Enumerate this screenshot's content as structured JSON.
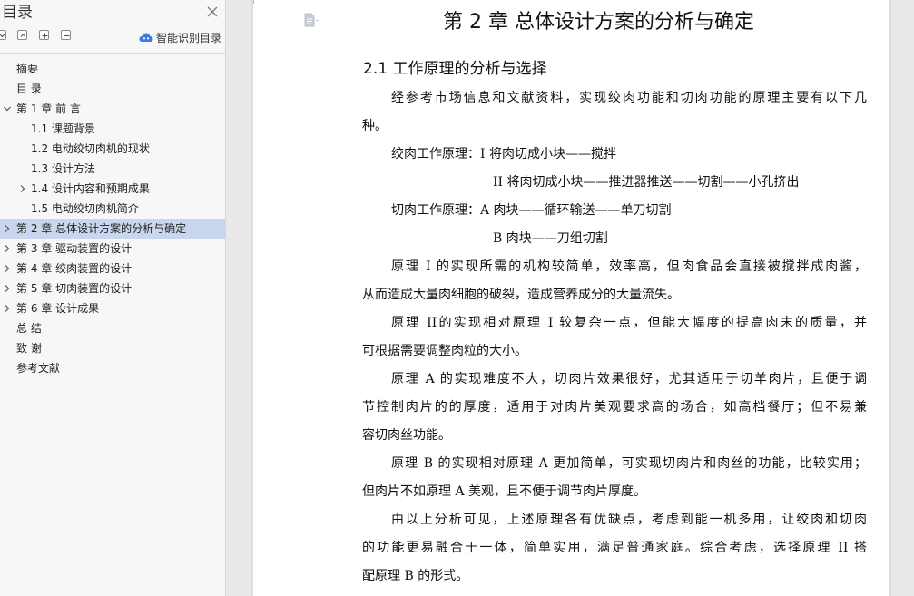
{
  "toc_panel": {
    "title": "目录",
    "smart_toc_label": "智能识别目录",
    "items": [
      {
        "label": "摘要",
        "level": 1,
        "arrow": "none"
      },
      {
        "label": "目 录",
        "level": 1,
        "arrow": "none"
      },
      {
        "label": "第 1 章 前 言",
        "level": 1,
        "arrow": "down"
      },
      {
        "label": "1.1 课题背景",
        "level": 2,
        "arrow": "none"
      },
      {
        "label": "1.2 电动绞切肉机的现状",
        "level": 2,
        "arrow": "none"
      },
      {
        "label": "1.3 设计方法",
        "level": 2,
        "arrow": "none"
      },
      {
        "label": "1.4 设计内容和预期成果",
        "level": 2,
        "arrow": "right"
      },
      {
        "label": "1.5 电动绞切肉机简介",
        "level": 2,
        "arrow": "none"
      },
      {
        "label": "第 2 章 总体设计方案的分析与确定",
        "level": 1,
        "arrow": "right",
        "active": true
      },
      {
        "label": "第 3 章 驱动装置的设计",
        "level": 1,
        "arrow": "right"
      },
      {
        "label": "第 4 章 绞肉装置的设计",
        "level": 1,
        "arrow": "right"
      },
      {
        "label": "第 5 章 切肉装置的设计",
        "level": 1,
        "arrow": "right"
      },
      {
        "label": "第 6 章 设计成果",
        "level": 1,
        "arrow": "right"
      },
      {
        "label": "总 结",
        "level": 1,
        "arrow": "none"
      },
      {
        "label": "致 谢",
        "level": 1,
        "arrow": "none"
      },
      {
        "label": "参考文献",
        "level": 1,
        "arrow": "none"
      }
    ]
  },
  "document": {
    "chapter_title": "第 2 章  总体设计方案的分析与确定",
    "section_title": "2.1  工作原理的分析与选择",
    "lines": {
      "p1a": "经参考市场信息和文献资料，实现绞肉功能和切肉功能的原理主要有以下几",
      "p1b": "种。",
      "p2": "绞肉工作原理：I 将肉切成小块——搅拌",
      "p3": "II 将肉切成小块——推进器推送——切割——小孔挤出",
      "p4": "切肉工作原理：A 肉块——循环输送——单刀切割",
      "p5": "B 肉块——刀组切割",
      "p6a": "原理 I 的实现所需的机构较简单，效率高，但肉食品会直接被搅拌成肉酱，",
      "p6b": "从而造成大量肉细胞的破裂，造成营养成分的大量流失。",
      "p7a": "原理 II的实现相对原理 I 较复杂一点，但能大幅度的提高肉末的质量，并",
      "p7b": "可根据需要调整肉粒的大小。",
      "p8a": "原理 A 的实现难度不大，切肉片效果很好，尤其适用于切羊肉片，且便于调",
      "p8b": "节控制肉片的的厚度，适用于对肉片美观要求高的场合，如高档餐厅；但不易兼",
      "p8c": "容切肉丝功能。",
      "p9a": "原理 B 的实现相对原理 A 更加简单，可实现切肉片和肉丝的功能，比较实用；",
      "p9b": "但肉片不如原理 A 美观，且不便于调节肉片厚度。",
      "p10a": "由以上分析可见，上述原理各有优缺点，考虑到能一机多用，让绞肉和切肉",
      "p10b": "的功能更易融合于一体，简单实用，满足普通家庭。综合考虑，选择原理 II 搭",
      "p10c": "配原理 B 的形式。"
    }
  },
  "colors": {
    "panel_bg": "#f7f7f7",
    "active_item_bg": "#c9d6ed",
    "smart_icon_blue": "#3b7ddd",
    "workspace_bg": "#e9e9e9"
  },
  "icons": {
    "close": "close-icon",
    "collapse_all": "collapse-all-icon",
    "expand_up": "chevron-up-icon",
    "add": "plus-icon",
    "remove": "minus-icon",
    "smart_toc": "cloud-ai-icon",
    "document": "document-icon"
  }
}
